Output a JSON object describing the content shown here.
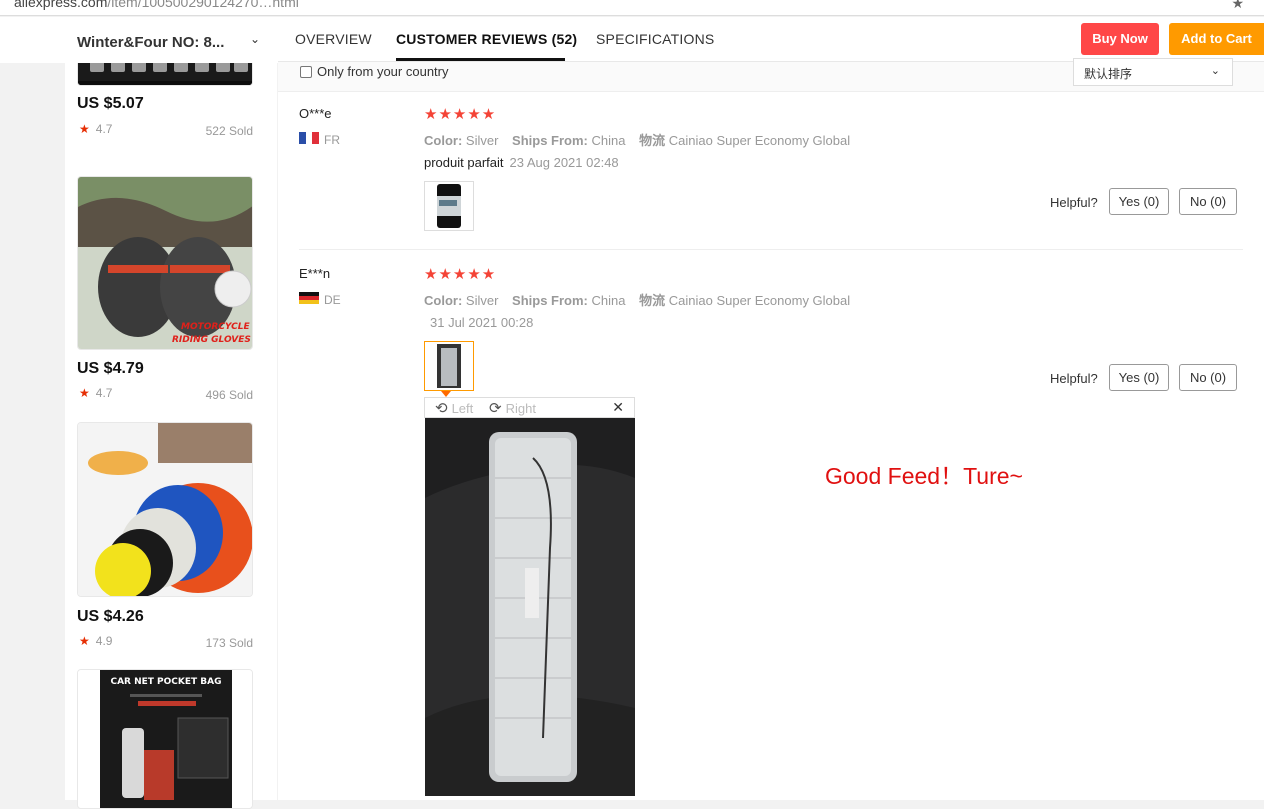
{
  "browser": {
    "url_host": "aliexpress.com",
    "url_path": "/item/100500290124270…html"
  },
  "store": {
    "name": "Winter&Four NO: 8..."
  },
  "sidebar_products": [
    {
      "price": "US $5.07",
      "rating": "4.7",
      "sold": "522 Sold",
      "image": "fm-transmitter"
    },
    {
      "price": "US $4.79",
      "rating": "4.7",
      "sold": "496 Sold",
      "image": "motorcycle-gloves",
      "image_text": "MOTORCYCLE RIDING GLOVES"
    },
    {
      "price": "US $4.26",
      "rating": "4.9",
      "sold": "173 Sold",
      "image": "polishing-pads"
    },
    {
      "image": "car-net-pocket-bag",
      "image_text": "CAR NET POCKET BAG"
    }
  ],
  "tabs": {
    "overview": "OVERVIEW",
    "reviews": "CUSTOMER REVIEWS (52)",
    "specs": "SPECIFICATIONS"
  },
  "actions": {
    "buy_now": "Buy Now",
    "add_to_cart": "Add to Cart"
  },
  "filters": {
    "only_country": "Only from your country",
    "sort_label": "默认排序"
  },
  "reviews": [
    {
      "user": "O***e",
      "country": "FR",
      "stars": "★★★★★",
      "color_label": "Color:",
      "color": "Silver",
      "ships_label": "Ships From:",
      "ships": "China",
      "logistics_label": "物流",
      "logistics": "Cainiao Super Economy Global",
      "text": "produit parfait",
      "date": "23 Aug 2021 02:48",
      "helpful": "Helpful?",
      "yes": "Yes (0)",
      "no": "No (0)"
    },
    {
      "user": "E***n",
      "country": "DE",
      "stars": "★★★★★",
      "color_label": "Color:",
      "color": "Silver",
      "ships_label": "Ships From:",
      "ships": "China",
      "logistics_label": "物流",
      "logistics": "Cainiao Super Economy Global",
      "text": "",
      "date": "31 Jul 2021 00:28",
      "helpful": "Helpful?",
      "yes": "Yes (0)",
      "no": "No (0)"
    }
  ],
  "viewer": {
    "left": "Left",
    "right": "Right",
    "close": "✕"
  },
  "annotation": "Good Feed！Ture~",
  "colors": {
    "buy_now": "#ff4747",
    "add_to_cart": "#ff9a00",
    "stars": "#f44336",
    "annotation": "#e01010"
  }
}
